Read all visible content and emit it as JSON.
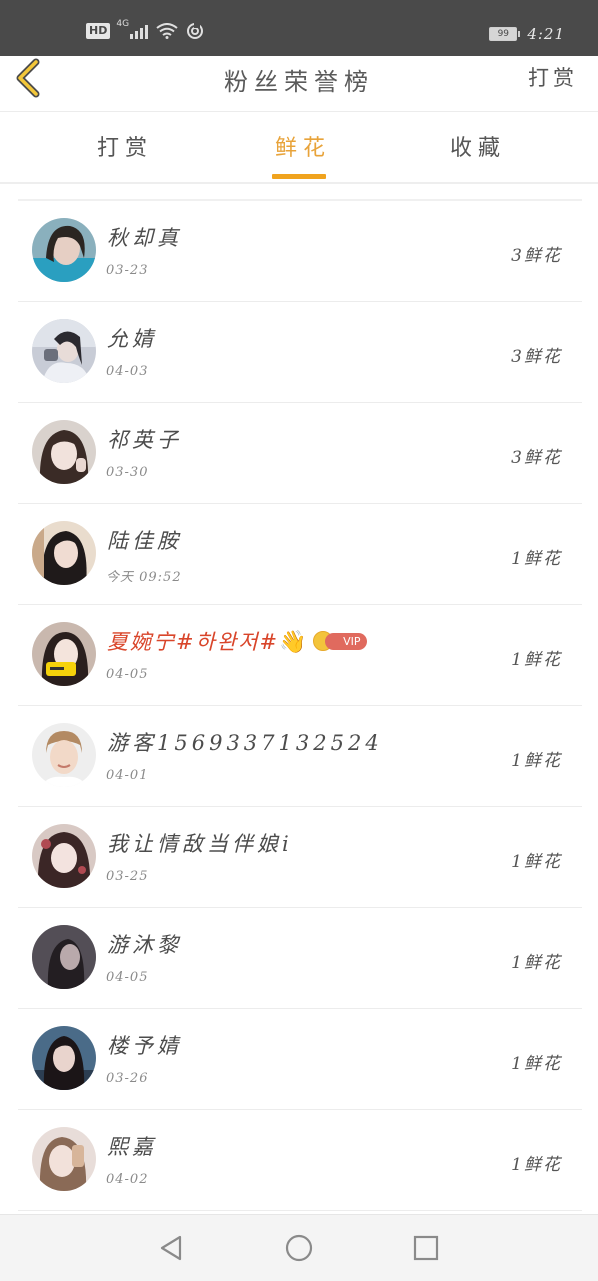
{
  "status_bar": {
    "hd": "HD",
    "network": "4G",
    "battery": "99",
    "time": "4:21",
    "icons": [
      "signal-icon",
      "wifi-icon",
      "sync-icon",
      "battery-icon"
    ]
  },
  "header": {
    "title": "粉丝荣誉榜",
    "action": "打赏",
    "back_icon": "chevron-left-icon"
  },
  "tabs": [
    {
      "label": "打赏",
      "active": false
    },
    {
      "label": "鲜花",
      "active": true
    },
    {
      "label": "收藏",
      "active": false
    }
  ],
  "colors": {
    "accent": "#f0a31e",
    "active_tab_text": "#e8a33a",
    "vip_name": "#d9452a",
    "status_bar_bg": "#4a4a4a"
  },
  "list": [
    {
      "name": "秋却真",
      "date": "03-23",
      "gift": "3鲜花"
    },
    {
      "name": "允婧",
      "date": "04-03",
      "gift": "3鲜花"
    },
    {
      "name": "祁英子",
      "date": "03-30",
      "gift": "3鲜花"
    },
    {
      "name": "陆佳胺",
      "date": "今天 09:52",
      "gift": "1鲜花"
    },
    {
      "name": "夏婉宁#하완저#",
      "date": "04-05",
      "gift": "1鲜花",
      "vip": "VIP",
      "emoji": "👋"
    },
    {
      "name": "游客1569337132524",
      "date": "04-01",
      "gift": "1鲜花"
    },
    {
      "name": "我让情敌当伴娘i",
      "date": "03-25",
      "gift": "1鲜花"
    },
    {
      "name": "游沐黎",
      "date": "04-05",
      "gift": "1鲜花"
    },
    {
      "name": "楼予婧",
      "date": "03-26",
      "gift": "1鲜花"
    },
    {
      "name": "熙嘉",
      "date": "04-02",
      "gift": "1鲜花"
    }
  ],
  "bottom_nav": [
    "back-triangle-icon",
    "home-circle-icon",
    "recents-square-icon"
  ]
}
